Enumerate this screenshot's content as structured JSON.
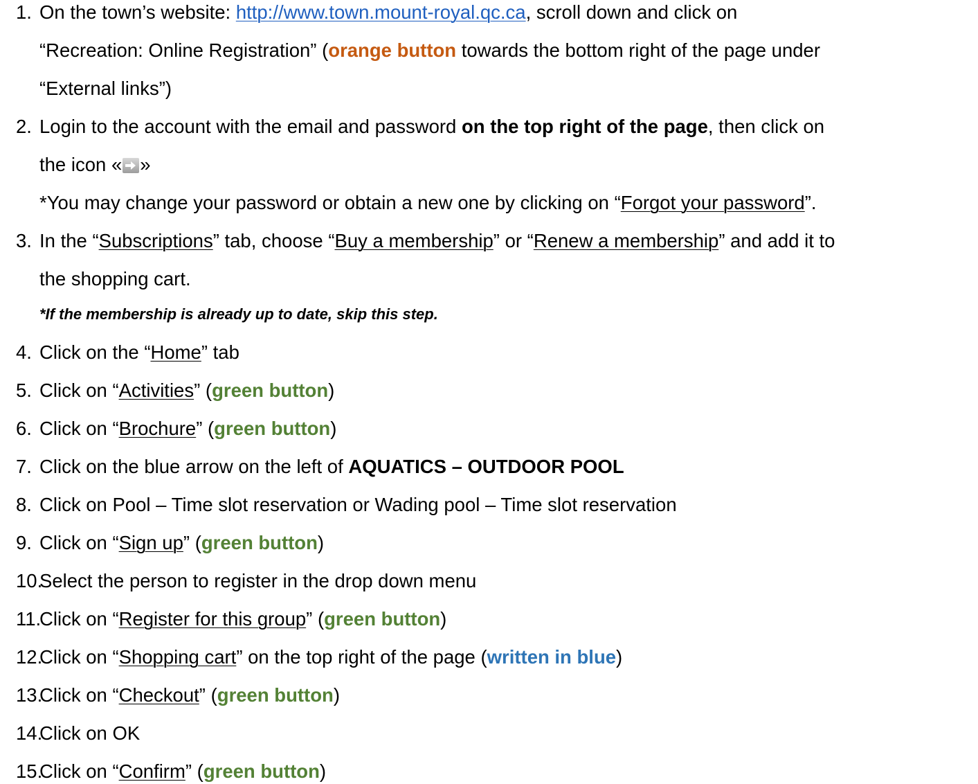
{
  "steps": [
    {
      "num": "1.",
      "a": "On the town’s website: ",
      "link": "http://www.town.mount-royal.qc.ca",
      "b": ", scroll down and click on",
      "l2a": "“Recreation: Online Registration” (",
      "orange": "orange button",
      "l2b": " towards the bottom right of the page under",
      "l3": "“External links”)"
    },
    {
      "num": "2.",
      "a": "Login to the account with the email and password ",
      "bold": "on the top right of the page",
      "b": ", then click on",
      "l2a": "the icon «",
      "l2b": "»",
      "l3a": "*You may change your password or obtain a new one by clicking on “",
      "l3u": "Forgot your password",
      "l3b": "”."
    },
    {
      "num": "3.",
      "a": "In the “",
      "u1": "Subscriptions",
      "b": "” tab, choose “",
      "u2": "Buy a membership",
      "c": "” or “",
      "u3": "Renew a membership",
      "d": "” and add it to",
      "l2": "the shopping cart.",
      "note": "*If the membership is already up to date, skip this step."
    },
    {
      "num": "4.",
      "a": "Click on the “",
      "u": "Home",
      "b": "” tab"
    },
    {
      "num": "5.",
      "a": "Click on “",
      "u": "Activities",
      "b": "” (",
      "g": "green button",
      "c": ")"
    },
    {
      "num": "6.",
      "a": "Click on “",
      "u": "Brochure",
      "b": "” (",
      "g": "green button",
      "c": ")"
    },
    {
      "num": "7.",
      "a": "Click on the blue arrow on the left of ",
      "bold": "AQUATICS – OUTDOOR POOL"
    },
    {
      "num": "8.",
      "a": "Click on Pool – Time slot reservation or Wading pool – Time slot reservation"
    },
    {
      "num": "9.",
      "a": "Click on “",
      "u": "Sign up",
      "b": "” (",
      "g": "green button",
      "c": ")"
    },
    {
      "num": "10.",
      "a": "Select the person to register in the drop down menu"
    },
    {
      "num": "11.",
      "a": "Click on “",
      "u": "Register for this group",
      "b": "” (",
      "g": "green button",
      "c": ")"
    },
    {
      "num": "12.",
      "a": "Click on “",
      "u": "Shopping cart",
      "b": "” on the top right of the page (",
      "bl": "written in blue",
      "c": ")"
    },
    {
      "num": "13.",
      "a": "Click on “",
      "u": "Checkout",
      "b": "” (",
      "g": "green button",
      "c": ")"
    },
    {
      "num": "14.",
      "a": "Click on OK"
    },
    {
      "num": "15.",
      "a": "Click on “",
      "u": "Confirm",
      "b": "” (",
      "g": "green button",
      "c": ")"
    }
  ],
  "colors": {
    "orange": "#c55a11",
    "green": "#538135",
    "blue": "#2e75b6",
    "link": "#1f5fbf"
  },
  "icons": {
    "login_arrow": "arrow-right-icon"
  }
}
